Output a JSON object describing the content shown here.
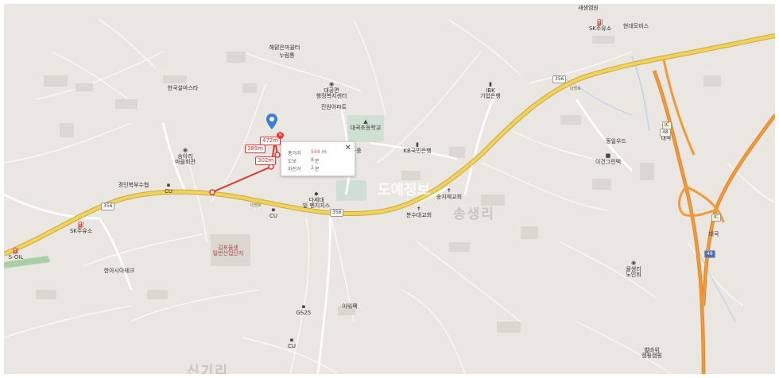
{
  "map": {
    "area_names": [
      "송생리",
      "신기리"
    ],
    "pois": [
      {
        "name": "새생염원",
        "icon": ""
      },
      {
        "name": "SK주유소",
        "icon": "fuel-icon"
      },
      {
        "name": "현대모비스",
        "icon": ""
      },
      {
        "name": "해맑은마을터",
        "icon": ""
      },
      {
        "name": "누림통",
        "icon": ""
      },
      {
        "name": "한국설마스타",
        "icon": ""
      },
      {
        "name": "대공면\n행정복지센터",
        "icon": "public-office-icon"
      },
      {
        "name": "진원아파트",
        "icon": ""
      },
      {
        "name": "IBK\n기업은행",
        "icon": "bank-icon"
      },
      {
        "name": "대곡초등학교",
        "icon": "school-icon"
      },
      {
        "name": "KB국민은행",
        "icon": "bank-icon"
      },
      {
        "name": "동일우드",
        "icon": ""
      },
      {
        "name": "이건그린텍",
        "icon": "building-icon"
      },
      {
        "name": "송아리\n마을회관",
        "icon": "public-office-icon"
      },
      {
        "name": "경인북부수협",
        "icon": ""
      },
      {
        "name": "CU",
        "icon": "store-icon"
      },
      {
        "name": "대곡중",
        "icon": "school-icon"
      },
      {
        "name": "다세대\n빌 펜지지스",
        "icon": ""
      },
      {
        "name": "송지제교회",
        "icon": "church-icon"
      },
      {
        "name": "분수대교회",
        "icon": "church-icon"
      },
      {
        "name": "CU",
        "icon": "store-icon"
      },
      {
        "name": "SK주유소",
        "icon": "fuel-icon"
      },
      {
        "name": "S-OIL",
        "icon": "fuel-icon"
      },
      {
        "name": "김포율생\n일반산업단지",
        "icon": ""
      },
      {
        "name": "한아시아테크",
        "icon": ""
      },
      {
        "name": "아워팩",
        "icon": ""
      },
      {
        "name": "GS25",
        "icon": "store-icon"
      },
      {
        "name": "CU",
        "icon": "store-icon"
      },
      {
        "name": "율생리\n노인회",
        "icon": "public-office-icon"
      },
      {
        "name": "벌바위\n캠핑캠핑",
        "icon": ""
      },
      {
        "name": "대곡",
        "icon": ""
      },
      {
        "name": "대곡",
        "icon": ""
      }
    ],
    "road_shields": [
      "356",
      "356",
      "356",
      "48",
      "48"
    ],
    "highway_labels": [
      "대명로",
      "대명로"
    ],
    "ic_labels": [
      "IC",
      "IC"
    ],
    "route": {
      "segment_labels": [
        "389m",
        "472m",
        "302m"
      ]
    },
    "info_box": {
      "total_distance_label": "총거리",
      "total_distance_value": "544",
      "total_distance_unit": "m",
      "walk_label": "도보",
      "walk_value": "8",
      "walk_unit": "분",
      "bike_label": "자전거",
      "bike_value": "2",
      "bike_unit": "분",
      "close_icon": "close-icon"
    },
    "watermark": "도예정보",
    "colors": {
      "main_road": "#f3d25a",
      "expressway": "#f29a38",
      "route_line": "#e03131",
      "pin": "#3b7ddd",
      "background": "#eae7e2"
    }
  }
}
